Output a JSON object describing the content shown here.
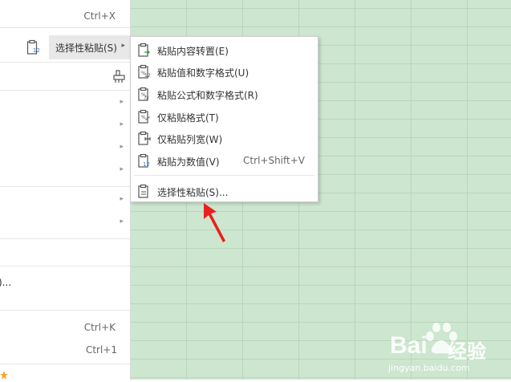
{
  "context_menu": {
    "cut_shortcut": "Ctrl+X",
    "paste_special_label": "选择性粘贴(S)",
    "partial_item": ")...",
    "shortcut_k": "Ctrl+K",
    "shortcut_1": "Ctrl+1",
    "arrow_glyph": "▸"
  },
  "submenu": {
    "items": [
      {
        "label": "粘贴内容转置(E)",
        "icon": "paste-transpose-icon",
        "shortcut": ""
      },
      {
        "label": "粘贴值和数字格式(U)",
        "icon": "paste-values-number-format-icon",
        "shortcut": ""
      },
      {
        "label": "粘贴公式和数字格式(R)",
        "icon": "paste-formulas-number-format-icon",
        "shortcut": ""
      },
      {
        "label": "仅粘贴格式(T)",
        "icon": "paste-formats-icon",
        "shortcut": ""
      },
      {
        "label": "仅粘贴列宽(W)",
        "icon": "paste-column-width-icon",
        "shortcut": ""
      },
      {
        "label": "粘贴为数值(V)",
        "icon": "paste-as-values-icon",
        "shortcut": "Ctrl+Shift+V"
      },
      {
        "label": "选择性粘贴(S)...",
        "icon": "paste-special-icon",
        "shortcut": ""
      }
    ]
  },
  "watermark": {
    "brand": "Bai",
    "brand_suffix": "经验",
    "url": "jingyan.baidu.com"
  },
  "colors": {
    "grid_bg": "#cde6cf",
    "grid_line": "#b9d6bb",
    "highlight": "#e8e8e8",
    "annotation_red": "#e8201c"
  }
}
